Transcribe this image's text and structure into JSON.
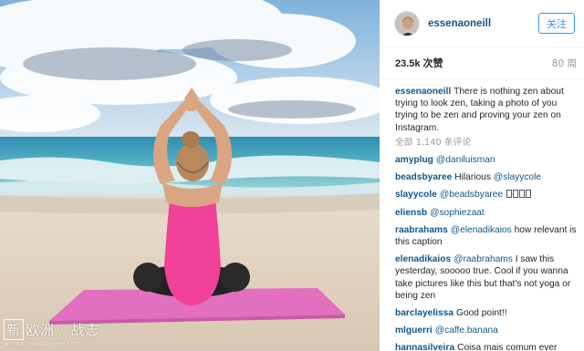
{
  "post": {
    "username": "essenaoneill",
    "follow_label": "关注",
    "likes_count": "23.5k",
    "likes_label": "次赞",
    "age": "80 周",
    "caption_user": "essenaoneill",
    "caption_text": "There is nothing zen about trying to look zen, taking a photo of you trying to be zen and proving your zen on Instagram.",
    "view_all_comments": "全部 1,140 条评论"
  },
  "comments": [
    {
      "user": "amyplug",
      "mention": "@daniluisman",
      "text": ""
    },
    {
      "user": "beadsbyaree",
      "text_before": "Hilarious ",
      "mention": "@slayycole"
    },
    {
      "user": "slayycole",
      "mention": "@beadsbyaree"
    },
    {
      "user": "eliensb",
      "mention": "@sophiezaat"
    },
    {
      "user": "raabrahams",
      "mention": "@elenadikaios",
      "text": " how relevant is this caption"
    },
    {
      "user": "elenadikaios",
      "mention": "@raabrahams",
      "text": " I saw this yesterday, sooooo true. Cool if you wanna take pictures like this but that's not yoga or being zen"
    },
    {
      "user": "barclayelissa",
      "text": "Good point!!"
    },
    {
      "user": "mlguerri",
      "mention": "@caffe.banana"
    },
    {
      "user": "hannasilveira",
      "text": "Coisa mais comum ever"
    }
  ],
  "watermark": {
    "mark": "新",
    "text": "欧洲 · 战志",
    "url": "www.xinoushangye.com"
  },
  "colors": {
    "link": "#125688",
    "follow_blue": "#3897f0",
    "muted": "#999999",
    "mat_pink": "#e36fc1",
    "top_pink": "#f0409a"
  }
}
